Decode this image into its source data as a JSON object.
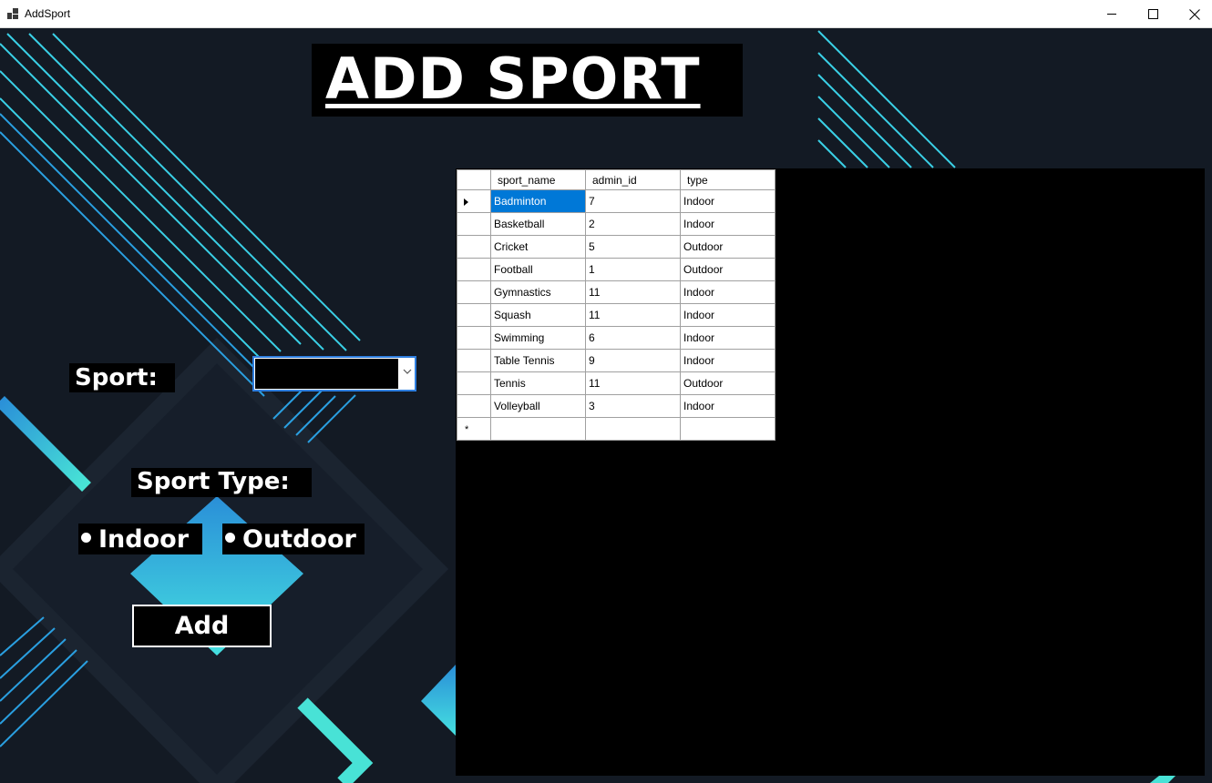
{
  "window": {
    "title": "AddSport",
    "controls": {
      "minimize": "minimize-icon",
      "maximize": "maximize-icon",
      "close": "close-icon"
    }
  },
  "heading": "ADD SPORT",
  "form": {
    "sport_label": "Sport:",
    "sport_value": "",
    "sport_type_label": "Sport Type:",
    "indoor_label": "Indoor",
    "outdoor_label": "Outdoor",
    "add_label": "Add"
  },
  "grid": {
    "columns": [
      "sport_name",
      "admin_id",
      "type"
    ],
    "rows": [
      [
        "Badminton",
        "7",
        "Indoor"
      ],
      [
        "Basketball",
        "2",
        "Indoor"
      ],
      [
        "Cricket",
        "5",
        "Outdoor"
      ],
      [
        "Football",
        "1",
        "Outdoor"
      ],
      [
        "Gymnastics",
        "11",
        "Indoor"
      ],
      [
        "Squash",
        "11",
        "Indoor"
      ],
      [
        "Swimming",
        "6",
        "Indoor"
      ],
      [
        "Table Tennis",
        "9",
        "Indoor"
      ],
      [
        "Tennis",
        "11",
        "Outdoor"
      ],
      [
        "Volleyball",
        "3",
        "Indoor"
      ]
    ],
    "new_row_marker": "*"
  },
  "colors": {
    "background": "#131a24",
    "accent_cyan": "#3ad0e6",
    "accent_blue": "#2a9fe0",
    "selection": "#0078d7"
  }
}
